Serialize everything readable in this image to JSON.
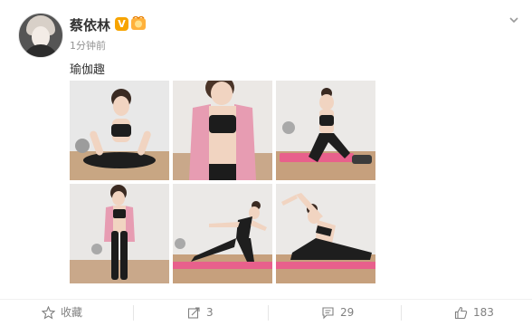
{
  "post": {
    "username": "蔡依林",
    "verified_badge": "V",
    "timestamp": "1分钟前",
    "text": "瑜伽趣"
  },
  "toolbar": {
    "favorite_label": "收藏",
    "repost_count": "3",
    "comment_count": "29",
    "like_count": "183"
  },
  "icons": {
    "avatar": "avatar",
    "medal": "medal-icon",
    "caret": "chevron-down-icon",
    "favorite": "star-icon",
    "repost": "repost-icon",
    "comment": "comment-icon",
    "like": "thumbs-up-icon"
  },
  "colors": {
    "badge": "#f7a400",
    "mat": "#e8608c",
    "text_muted": "#808080"
  }
}
